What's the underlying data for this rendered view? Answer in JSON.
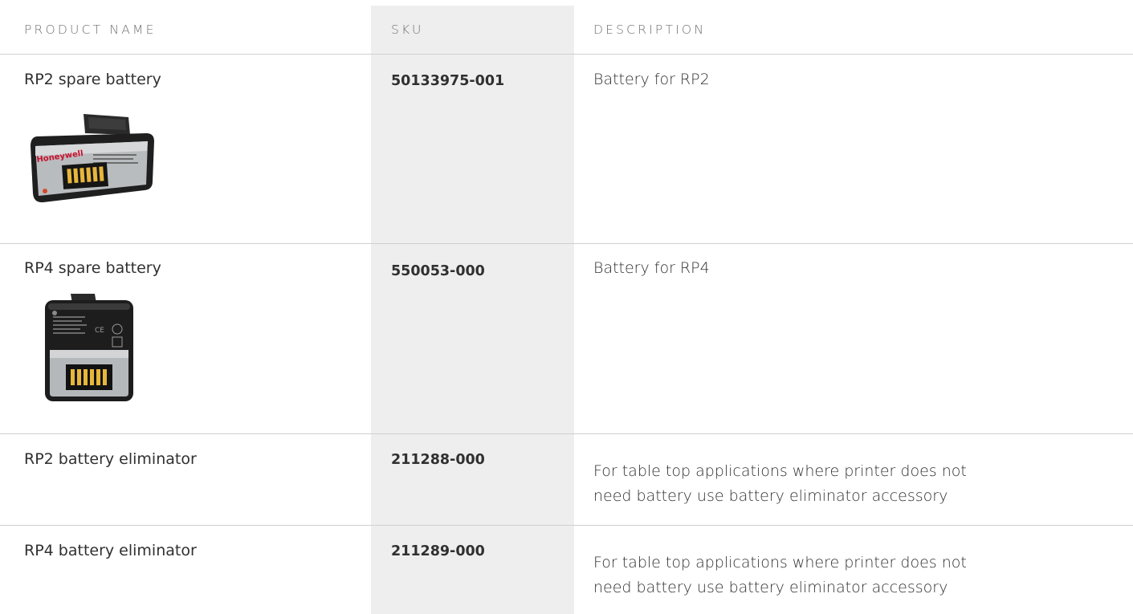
{
  "table": {
    "headers": {
      "product_name": "PRODUCT NAME",
      "sku": "SKU",
      "description": "DESCRIPTION"
    },
    "rows": [
      {
        "product_name": "RP2 spare battery",
        "sku": "50133975-001",
        "description": "Battery for RP2",
        "image": "rp2-battery-image"
      },
      {
        "product_name": "RP4 spare battery",
        "sku": "550053-000",
        "description": "Battery for RP4",
        "image": "rp4-battery-image"
      },
      {
        "product_name": "RP2 battery eliminator",
        "sku": "211288-000",
        "description_line1": "For table top applications where printer does not",
        "description_line2": "need battery use battery eliminator accessory"
      },
      {
        "product_name": "RP4 battery eliminator",
        "sku": "211289-000",
        "description_line1": "For table top applications where printer does not",
        "description_line2": "need battery use battery eliminator accessory"
      }
    ]
  },
  "logo_text": "Honeywell",
  "colors": {
    "sku_column_bg": "#eeeeee",
    "divider": "#cfcfcf",
    "text": "#303030",
    "header_text": "#707070"
  }
}
